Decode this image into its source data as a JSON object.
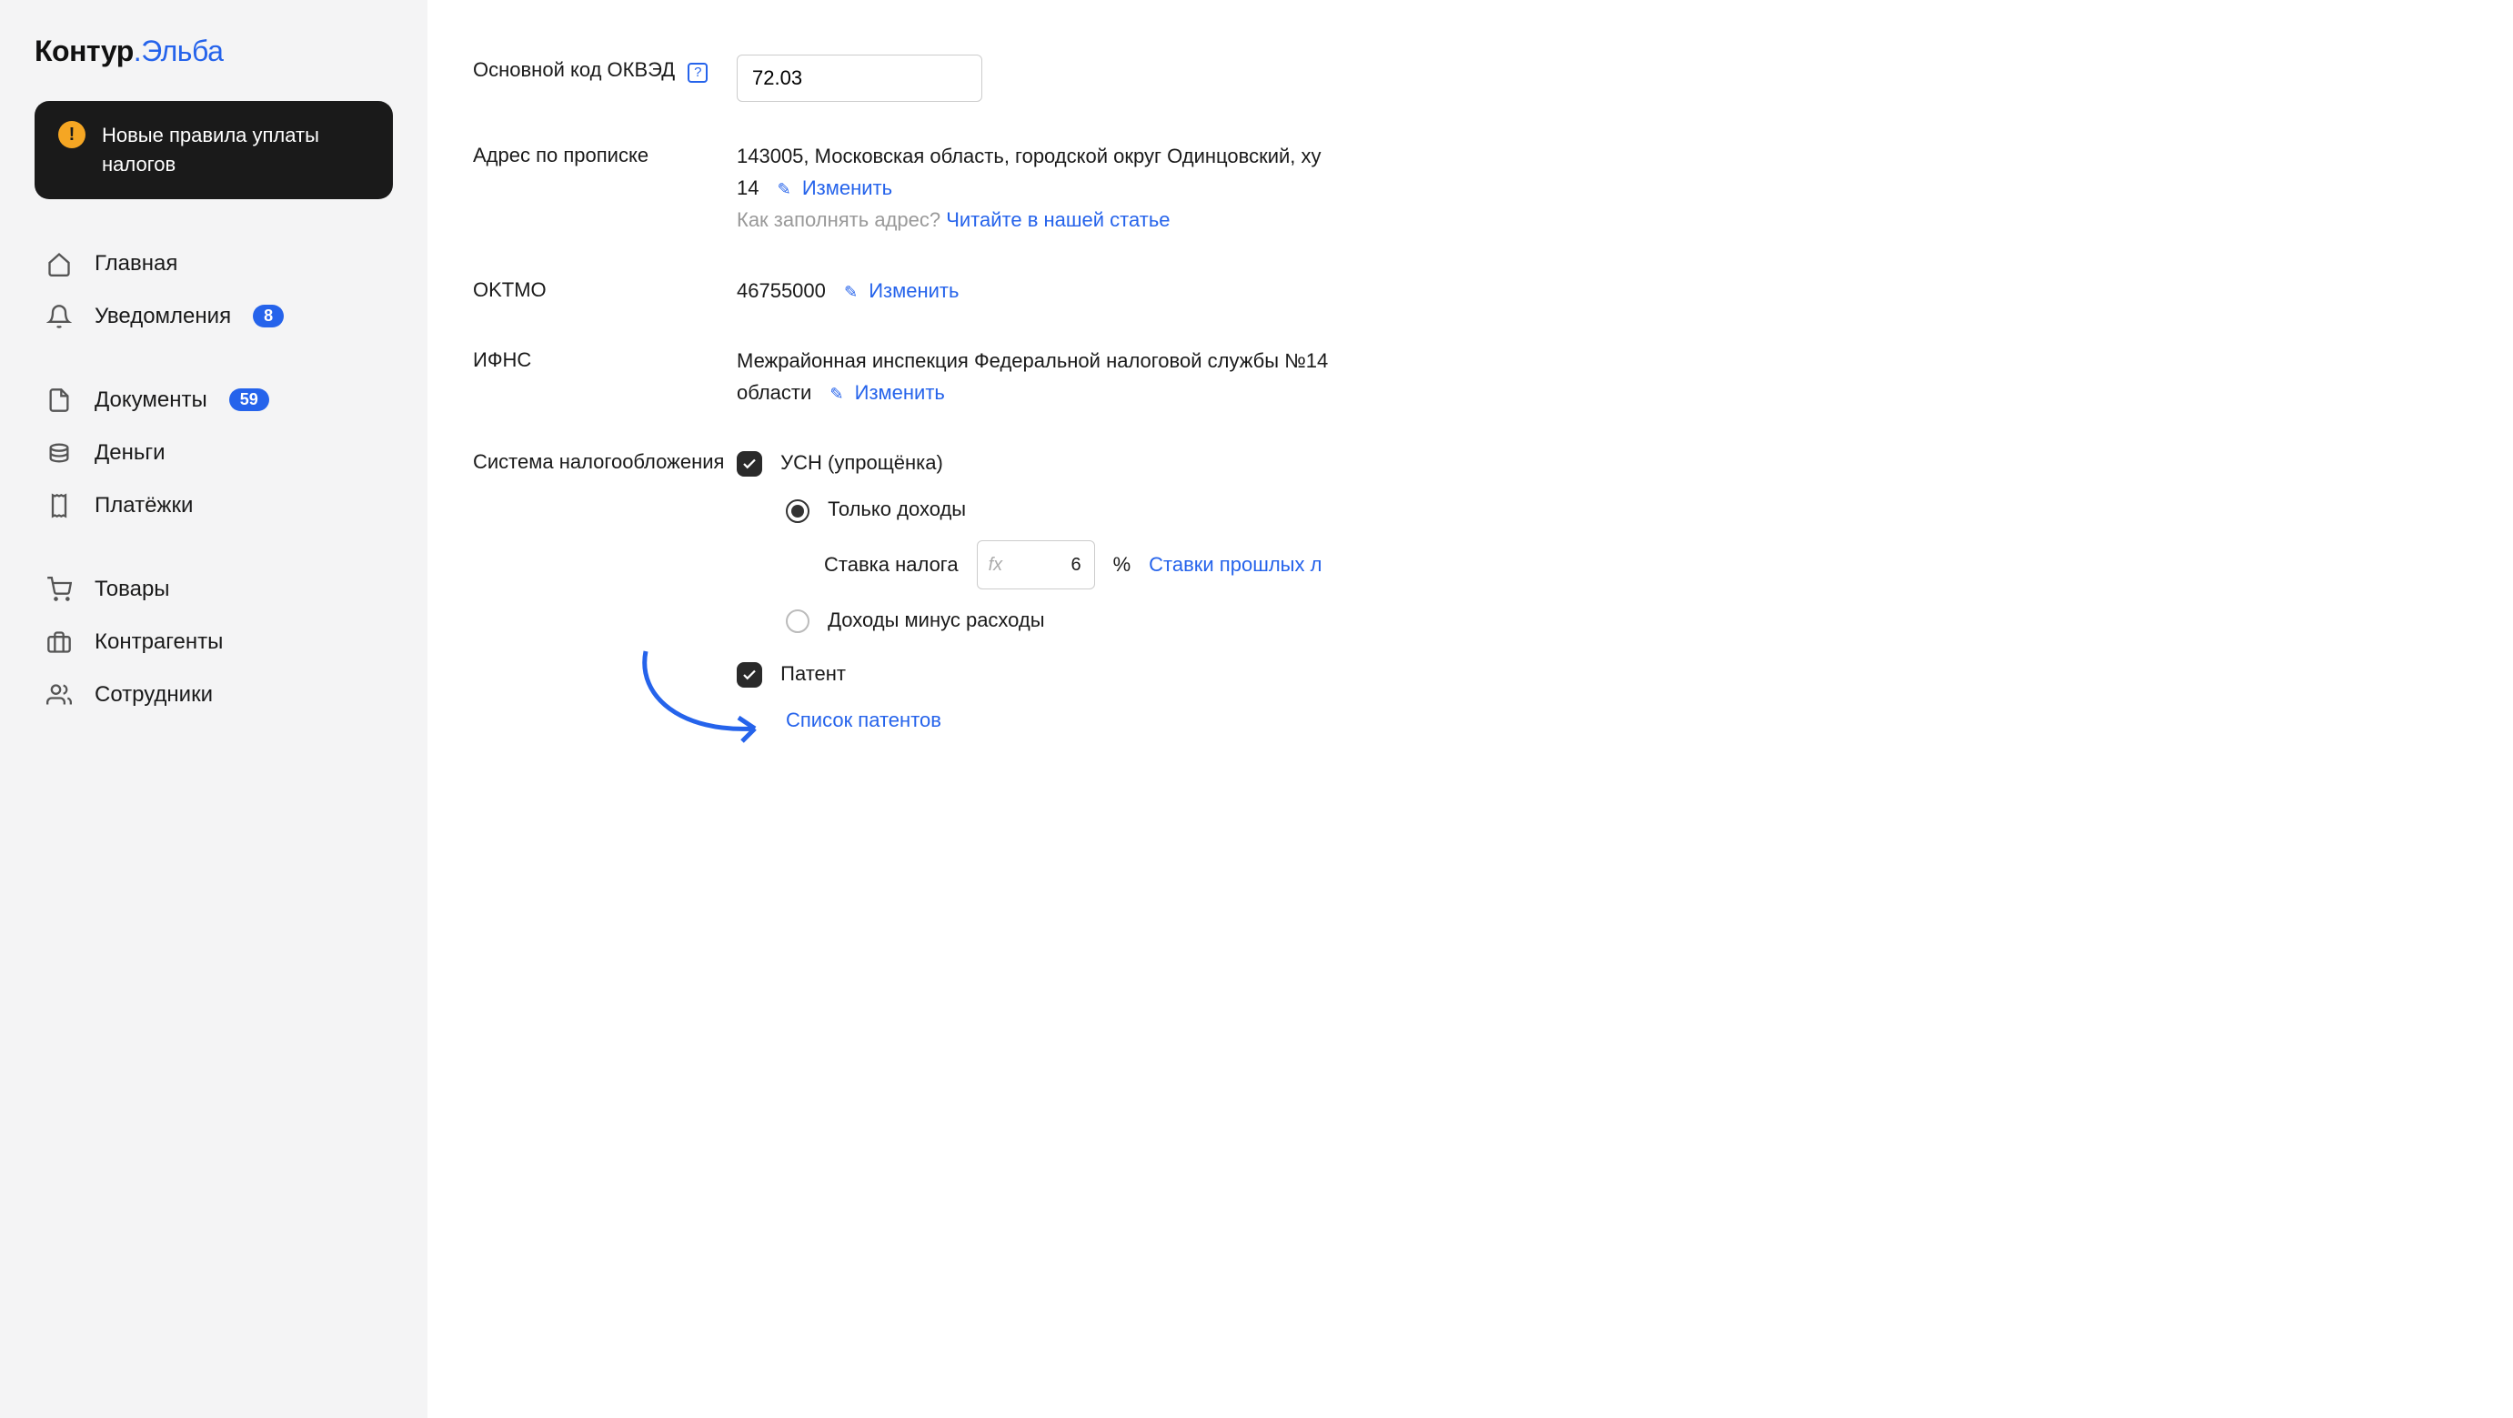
{
  "logo": {
    "part1": "Контур",
    "part2": ".Эльба"
  },
  "alert": {
    "text": "Новые правила уплаты налогов"
  },
  "nav": {
    "home": "Главная",
    "notifications": "Уведомления",
    "notifications_badge": "8",
    "documents": "Документы",
    "documents_badge": "59",
    "money": "Деньги",
    "payments": "Платёжки",
    "goods": "Товары",
    "contractors": "Контрагенты",
    "employees": "Сотрудники"
  },
  "form": {
    "okved_label": "Основной код ОКВЭД",
    "okved_value": "72.03",
    "help_q": "?",
    "address_label": "Адрес по прописке",
    "address_value": "143005, Московская область, городской округ Одинцовский, ху",
    "address_num": "14",
    "edit": "Изменить",
    "address_hint_prefix": "Как заполнять адрес? ",
    "address_hint_link": "Читайте в нашей статье",
    "oktmo_label": "OKTMO",
    "oktmo_value": "46755000",
    "ifns_label": "ИФНС",
    "ifns_value": "Межрайонная инспекция Федеральной налоговой службы №14",
    "ifns_value2": "области",
    "tax_label": "Система налогообложения",
    "usn": "УСН (упрощёнка)",
    "income_only": "Только доходы",
    "rate_label": "Ставка налога",
    "rate_value": "6",
    "percent": "%",
    "fx": "fx",
    "past_rates": "Ставки прошлых л",
    "income_minus": "Доходы минус расходы",
    "patent": "Патент",
    "patent_list": "Список патентов"
  }
}
